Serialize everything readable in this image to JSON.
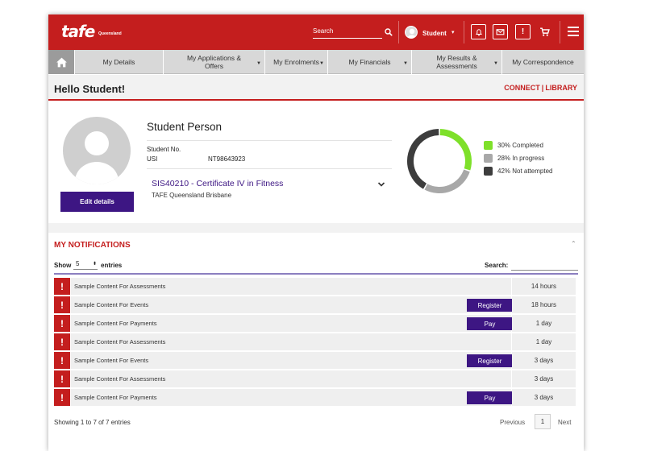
{
  "header": {
    "logo": "tafe",
    "logo_sub": "Queensland",
    "search_placeholder": "Search",
    "user": "Student"
  },
  "nav": {
    "items": [
      {
        "label": "My Details",
        "caret": false
      },
      {
        "label": "My Applications & Offers",
        "caret": true
      },
      {
        "label": "My Enrolments",
        "caret": true
      },
      {
        "label": "My Financials",
        "caret": true
      },
      {
        "label": "My Results & Assessments",
        "caret": true
      },
      {
        "label": "My Correspondence",
        "caret": false
      }
    ]
  },
  "hello": {
    "greeting": "Hello Student!",
    "connect": "CONNECT",
    "library": "LIBRARY"
  },
  "profile": {
    "name": "Student Person",
    "student_no_label": "Student No.",
    "student_no_value": "",
    "usi_label": "USI",
    "usi_value": "NT98643923",
    "course": "SIS40210 - Certificate IV in Fitness",
    "campus": "TAFE Queensland Brisbane",
    "edit_label": "Edit details"
  },
  "progress": {
    "segments": [
      {
        "label": "30% Completed",
        "value": 30,
        "color": "#7ee02a"
      },
      {
        "label": "28% In progress",
        "value": 28,
        "color": "#a8a8a8"
      },
      {
        "label": "42% Not attempted",
        "value": 42,
        "color": "#3d3d3d"
      }
    ]
  },
  "notifications": {
    "title": "MY NOTIFICATIONS",
    "show_label": "Show",
    "show_value": "5",
    "entries_label": "entries",
    "search_label": "Search:",
    "rows": [
      {
        "text": "Sample Content For Assessments",
        "action": "",
        "time": "14 hours"
      },
      {
        "text": "Sample Content For Events",
        "action": "Register",
        "time": "18 hours"
      },
      {
        "text": "Sample Content For Payments",
        "action": "Pay",
        "time": "1 day"
      },
      {
        "text": "Sample Content For Assessments",
        "action": "",
        "time": "1 day"
      },
      {
        "text": "Sample Content For Events",
        "action": "Register",
        "time": "3 days"
      },
      {
        "text": "Sample Content For Assessments",
        "action": "",
        "time": "3 days"
      },
      {
        "text": "Sample Content For Payments",
        "action": "Pay",
        "time": "3 days"
      }
    ],
    "showing": "Showing 1 to 7 of 7 entries",
    "previous": "Previous",
    "page": "1",
    "next": "Next"
  },
  "colors": {
    "brand_red": "#c41e1e",
    "brand_purple": "#3d1683"
  }
}
